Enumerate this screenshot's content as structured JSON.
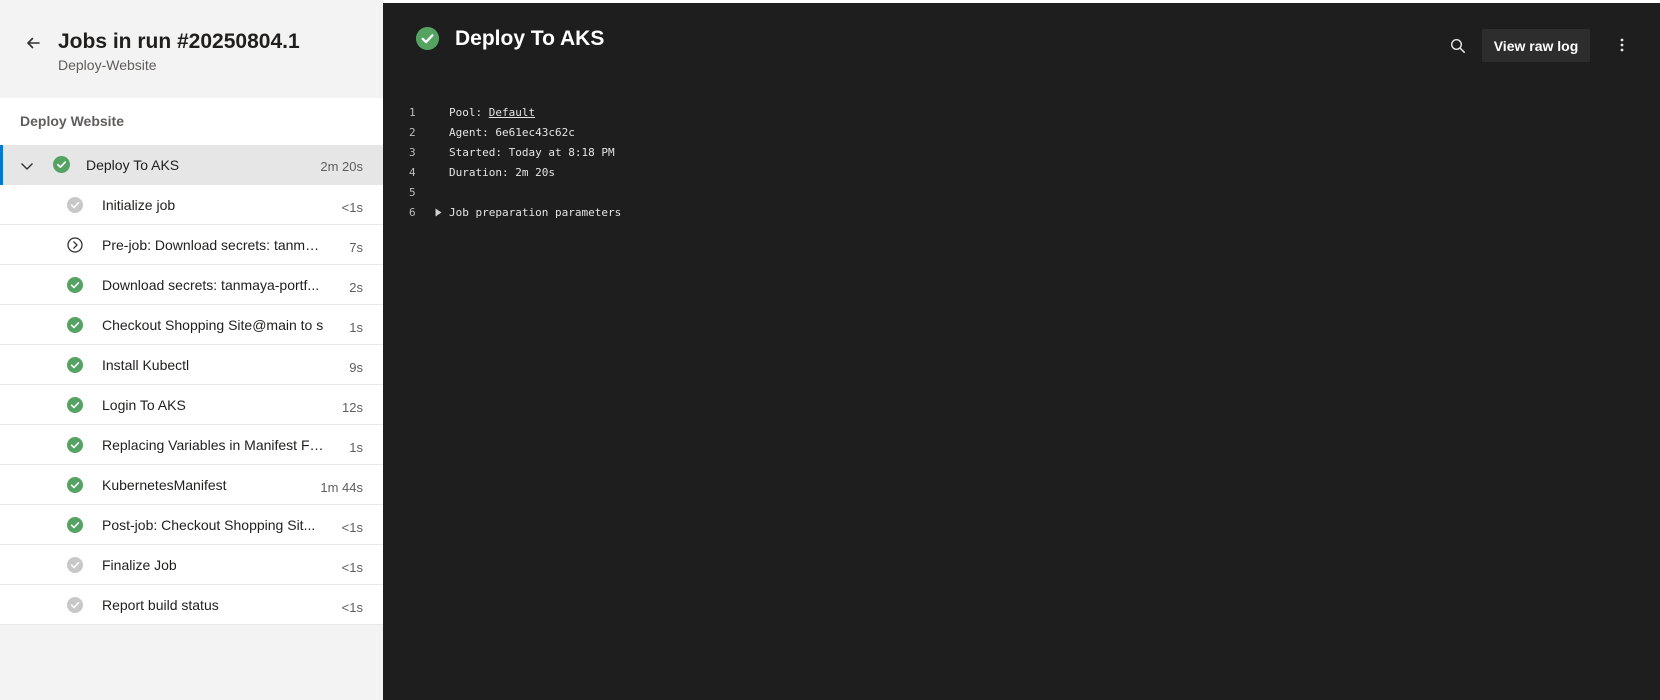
{
  "header": {
    "title": "Jobs in run #20250804.1",
    "subtitle": "Deploy-Website"
  },
  "stage": {
    "title": "Deploy Website"
  },
  "job": {
    "name": "Deploy To AKS",
    "duration": "2m 20s",
    "status": "success"
  },
  "steps": [
    {
      "name": "Initialize job",
      "duration": "<1s",
      "status": "skipped"
    },
    {
      "name": "Pre-job: Download secrets: tanma...",
      "duration": "7s",
      "status": "pending"
    },
    {
      "name": "Download secrets: tanmaya-portf...",
      "duration": "2s",
      "status": "success"
    },
    {
      "name": "Checkout Shopping Site@main to s",
      "duration": "1s",
      "status": "success"
    },
    {
      "name": "Install Kubectl",
      "duration": "9s",
      "status": "success"
    },
    {
      "name": "Login To AKS",
      "duration": "12s",
      "status": "success"
    },
    {
      "name": "Replacing Variables in Manifest Fil...",
      "duration": "1s",
      "status": "success"
    },
    {
      "name": "KubernetesManifest",
      "duration": "1m 44s",
      "status": "success"
    },
    {
      "name": "Post-job: Checkout Shopping Sit...",
      "duration": "<1s",
      "status": "success"
    },
    {
      "name": "Finalize Job",
      "duration": "<1s",
      "status": "skipped"
    },
    {
      "name": "Report build status",
      "duration": "<1s",
      "status": "skipped"
    }
  ],
  "log": {
    "title": "Deploy To AKS",
    "view_raw_label": "View raw log",
    "lines": [
      {
        "num": "1",
        "label": "Pool: ",
        "link": "Default"
      },
      {
        "num": "2",
        "text": "Agent: 6e61ec43c62c"
      },
      {
        "num": "3",
        "text": "Started: Today at 8:18 PM"
      },
      {
        "num": "4",
        "text": "Duration: 2m 20s"
      },
      {
        "num": "5",
        "text": ""
      },
      {
        "num": "6",
        "text": "Job preparation parameters",
        "expandable": true
      }
    ]
  },
  "colors": {
    "success": "#55a362",
    "skipped": "#c8c8c8",
    "accent": "#0078d4",
    "log_background": "#1e1e1e"
  },
  "icons": {
    "back": "arrow-left-icon",
    "chevron": "chevron-down-icon",
    "success": "check-circle-icon",
    "skipped": "skipped-circle-icon",
    "pending": "chevron-right-circle-icon",
    "search": "search-icon",
    "more": "more-vertical-icon",
    "expander": "triangle-right-icon"
  }
}
